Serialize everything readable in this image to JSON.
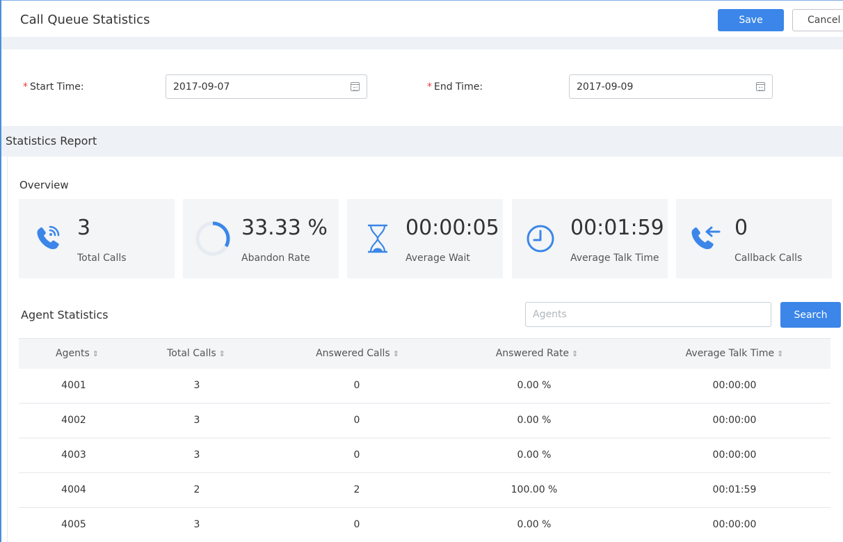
{
  "header": {
    "title": "Call Queue Statistics",
    "save_label": "Save",
    "cancel_label": "Cancel"
  },
  "form": {
    "start_time": {
      "required_mark": "*",
      "label": "Start Time:",
      "value": "2017-09-07"
    },
    "end_time": {
      "required_mark": "*",
      "label": "End Time:",
      "value": "2017-09-09"
    }
  },
  "report": {
    "section_title": "Statistics Report",
    "overview_title": "Overview",
    "cards": [
      {
        "value": "3",
        "caption": "Total Calls",
        "icon": "phone-ringing-icon"
      },
      {
        "value": "33.33 %",
        "caption": "Abandon Rate",
        "icon": "abandon-rate-ring-icon"
      },
      {
        "value": "00:00:05",
        "caption": "Average Wait",
        "icon": "hourglass-icon"
      },
      {
        "value": "00:01:59",
        "caption": "Average Talk Time",
        "icon": "clock-icon"
      },
      {
        "value": "0",
        "caption": "Callback Calls",
        "icon": "phone-callback-icon"
      }
    ]
  },
  "agents": {
    "title": "Agent Statistics",
    "search_placeholder": "Agents",
    "search_label": "Search",
    "sort_glyph": "⇕",
    "columns": [
      "Agents",
      "Total Calls",
      "Answered Calls",
      "Answered Rate",
      "Average Talk Time"
    ],
    "rows": [
      [
        "4001",
        "3",
        "0",
        "0.00 %",
        "00:00:00"
      ],
      [
        "4002",
        "3",
        "0",
        "0.00 %",
        "00:00:00"
      ],
      [
        "4003",
        "3",
        "0",
        "0.00 %",
        "00:00:00"
      ],
      [
        "4004",
        "2",
        "2",
        "100.00 %",
        "00:01:59"
      ],
      [
        "4005",
        "3",
        "0",
        "0.00 %",
        "00:00:00"
      ]
    ]
  },
  "colors": {
    "accent": "#3b86e8",
    "required": "#e23b3b",
    "card_bg": "#f3f5f7",
    "band_bg": "#eef1f5"
  }
}
